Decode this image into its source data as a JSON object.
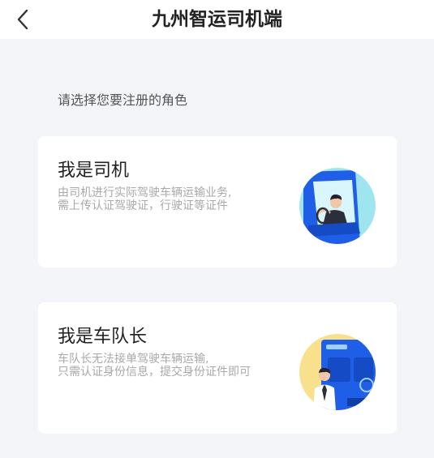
{
  "header": {
    "title": "九州智运司机端"
  },
  "prompt": "请选择您要注册的角色",
  "roles": [
    {
      "title": "我是司机",
      "desc_line1": "由司机进行实际驾驶车辆运输业务,",
      "desc_line2": "需上传认证驾驶证，行驶证等证件",
      "illustration": "truck-driver-illustration"
    },
    {
      "title": "我是车队长",
      "desc_line1": "车队长无法接单驾驶车辆运输,",
      "desc_line2": "只需认证身份信息，提交身份证件即可",
      "illustration": "fleet-captain-illustration"
    }
  ],
  "colors": {
    "brand_blue": "#1f5fe8",
    "driver_bg": "#9fe5ef",
    "captain_bg": "#f9e08c"
  }
}
